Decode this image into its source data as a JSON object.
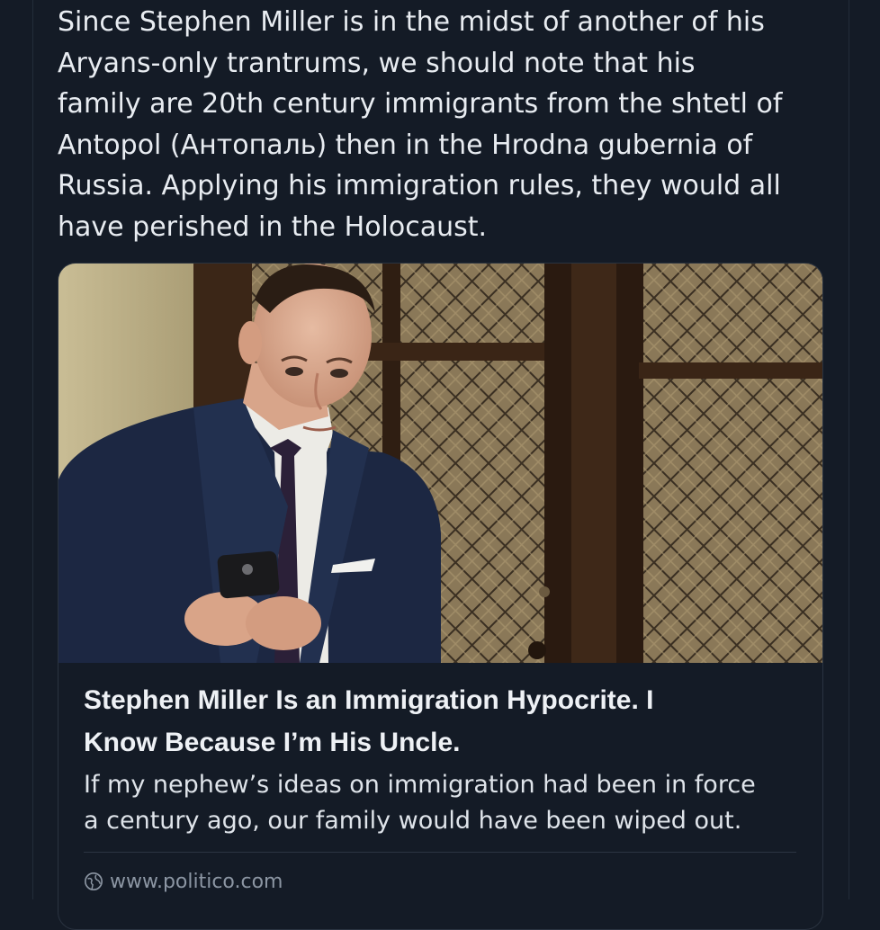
{
  "post": {
    "lines": [
      "Since Stephen Miller is in the midst of another of his",
      "Aryans-only trantrums, we should note that his",
      "family are 20th century immigrants from the shtetl of",
      "Antopol (Антопаль) then in the Hrodna gubernia of",
      "Russia. Applying his immigration rules, they would all",
      "have perished in the Holocaust."
    ]
  },
  "link_card": {
    "headline_lines": [
      "Stephen Miller Is an Immigration Hypocrite. I",
      "Know Because I’m His Uncle."
    ],
    "summary_lines": [
      "If my nephew’s ideas on immigration had been in force",
      "a century ago, our family would have been wiped out."
    ],
    "source_icon": "globe-icon",
    "source_domain": "www.politico.com"
  },
  "colors": {
    "background": "#141b26",
    "text": "#e8ecf1",
    "muted": "#8c96a3"
  }
}
